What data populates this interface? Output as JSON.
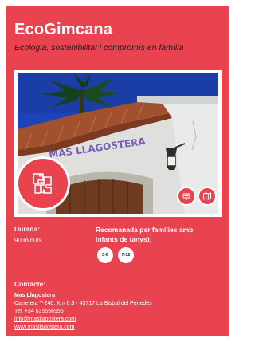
{
  "header": {
    "title": "EcoGimcana",
    "subtitle": "Ecologia, sostenibilitat i compromís en família"
  },
  "photo": {
    "sign_text": "MAS LLAGOSTERA"
  },
  "badges": {
    "main_icon": "puzzle-pieces-icon",
    "secondary_icons": [
      "sign-icon",
      "map-icon"
    ]
  },
  "info": {
    "duration_label": "Durada:",
    "duration_value": "90 minuts",
    "recommended_label": "Recomanada per famílies amb infants de (anys):",
    "age_ranges": [
      "3-6",
      "7-12"
    ]
  },
  "contact": {
    "label": "Contacte:",
    "name": "Mas Llagostera",
    "address": "Carretera T-240, Km 0.5 - 43717 La Bisbal del Penedès",
    "phone": "Tel. +34 635556955",
    "email": "info@masllagostera.com",
    "website": "www.masllagostera.com"
  },
  "colors": {
    "brand_red": "#e8434f",
    "text_dark": "#1e1e1e",
    "white": "#ffffff"
  }
}
